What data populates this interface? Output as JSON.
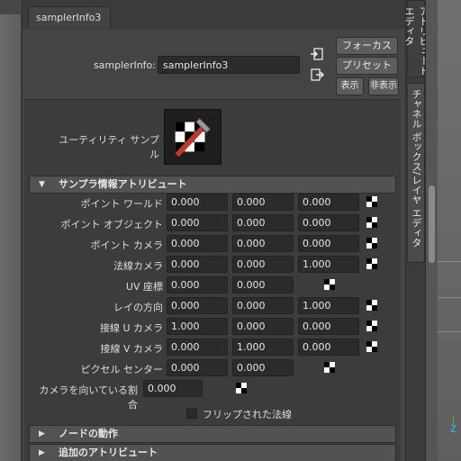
{
  "tab": {
    "title": "samplerInfo3"
  },
  "node": {
    "label": "samplerInfo:",
    "value": "samplerInfo3"
  },
  "buttons": {
    "focus": "フォーカス",
    "preset": "プリセット",
    "show": "表示",
    "hide": "非表示"
  },
  "utility": {
    "label": "ユーティリティ サンプル"
  },
  "sections": {
    "sampler_info": "サンプラ情報アトリビュート",
    "node_behavior": "ノードの動作",
    "extra_attributes": "追加のアトリビュート"
  },
  "attributes": [
    {
      "label": "ポイント ワールド",
      "values": [
        "0.000",
        "0.000",
        "0.000"
      ]
    },
    {
      "label": "ポイント オブジェクト",
      "values": [
        "0.000",
        "0.000",
        "0.000"
      ]
    },
    {
      "label": "ポイント カメラ",
      "values": [
        "0.000",
        "0.000",
        "0.000"
      ]
    },
    {
      "label": "法線カメラ",
      "values": [
        "0.000",
        "0.000",
        "1.000"
      ]
    },
    {
      "label": "UV 座標",
      "values": [
        "0.000",
        "0.000"
      ]
    },
    {
      "label": "レイの方向",
      "values": [
        "0.000",
        "0.000",
        "1.000"
      ]
    },
    {
      "label": "接線 U カメラ",
      "values": [
        "1.000",
        "0.000",
        "0.000"
      ]
    },
    {
      "label": "接線 V カメラ",
      "values": [
        "0.000",
        "1.000",
        "0.000"
      ]
    },
    {
      "label": "ピクセル センター",
      "values": [
        "0.000",
        "0.000"
      ]
    },
    {
      "label": "カメラを向いている割合",
      "values": [
        "0.000"
      ]
    }
  ],
  "flip": {
    "label": "フリップされた法線",
    "checked": false
  },
  "side_tabs": {
    "attribute_editor": "アトリビュート エディタ",
    "channel_box": "チャネル ボックス/レイヤ エディタ"
  },
  "viewport": {
    "axis_label": "Z"
  },
  "icons": [
    "input-connection-icon",
    "output-connection-icon",
    "checker-map-icon",
    "collapse-triangle-icon",
    "expand-triangle-icon"
  ],
  "colors": {
    "panel_bg": "#444444",
    "field_bg": "#2b2b2b",
    "section_bg": "#525252",
    "axis_z": "#3fa0ff"
  }
}
